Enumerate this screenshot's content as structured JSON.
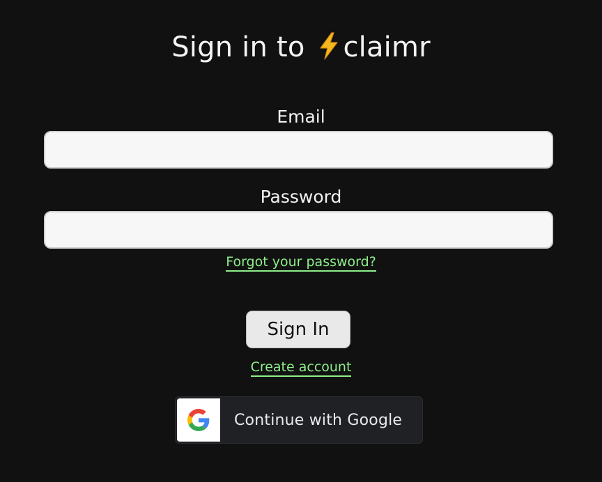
{
  "header": {
    "title_prefix": "Sign in to",
    "brand_icon": "lightning-bolt-icon",
    "brand_name": "claimr"
  },
  "form": {
    "email_label": "Email",
    "email_value": "",
    "password_label": "Password",
    "password_value": "",
    "forgot_password_link": "Forgot your password?",
    "signin_button": "Sign In",
    "create_account_link": "Create account"
  },
  "oauth": {
    "google_button": "Continue with Google",
    "google_icon": "google-g-icon"
  },
  "colors": {
    "background": "#111111",
    "link": "#8ef08a",
    "input_bg": "#f7f7f7",
    "google_button_bg": "#202124"
  }
}
